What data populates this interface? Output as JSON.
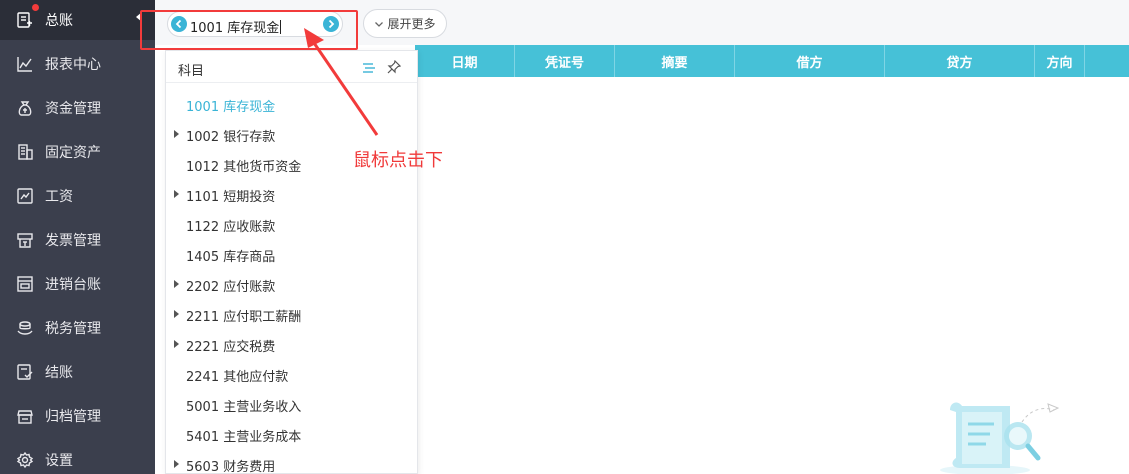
{
  "sidebar": {
    "items": [
      {
        "label": "总账",
        "icon": "ledger-icon"
      },
      {
        "label": "报表中心",
        "icon": "chart-icon"
      },
      {
        "label": "资金管理",
        "icon": "money-bag-icon"
      },
      {
        "label": "固定资产",
        "icon": "building-icon"
      },
      {
        "label": "工资",
        "icon": "salary-icon"
      },
      {
        "label": "发票管理",
        "icon": "invoice-icon"
      },
      {
        "label": "进销台账",
        "icon": "ledger-book-icon"
      },
      {
        "label": "税务管理",
        "icon": "tax-icon"
      },
      {
        "label": "结账",
        "icon": "checkout-icon"
      },
      {
        "label": "归档管理",
        "icon": "archive-icon"
      },
      {
        "label": "设置",
        "icon": "gear-icon"
      }
    ]
  },
  "toolbar": {
    "current_subject": "1001 库存现金",
    "expand_label": "展开更多"
  },
  "table": {
    "columns": [
      "日期",
      "凭证号",
      "摘要",
      "借方",
      "贷方",
      "方向"
    ]
  },
  "dropdown": {
    "title": "科目",
    "items": [
      {
        "label": "1001 库存现金",
        "expandable": false,
        "active": true
      },
      {
        "label": "1002 银行存款",
        "expandable": true
      },
      {
        "label": "1012 其他货币资金",
        "expandable": false
      },
      {
        "label": "1101 短期投资",
        "expandable": true
      },
      {
        "label": "1122 应收账款",
        "expandable": false
      },
      {
        "label": "1405 库存商品",
        "expandable": false
      },
      {
        "label": "2202 应付账款",
        "expandable": true
      },
      {
        "label": "2211 应付职工薪酬",
        "expandable": true
      },
      {
        "label": "2221 应交税费",
        "expandable": true
      },
      {
        "label": "2241 其他应付款",
        "expandable": false
      },
      {
        "label": "5001 主营业务收入",
        "expandable": false
      },
      {
        "label": "5401 主营业务成本",
        "expandable": false
      },
      {
        "label": "5603 财务费用",
        "expandable": true
      }
    ]
  },
  "annotation": {
    "text": "鼠标点击下"
  },
  "colors": {
    "sidebar_bg": "#3b3f4d",
    "accent": "#3ab4d6",
    "table_header": "#46c1d7",
    "annotation_red": "#f23b3b"
  }
}
